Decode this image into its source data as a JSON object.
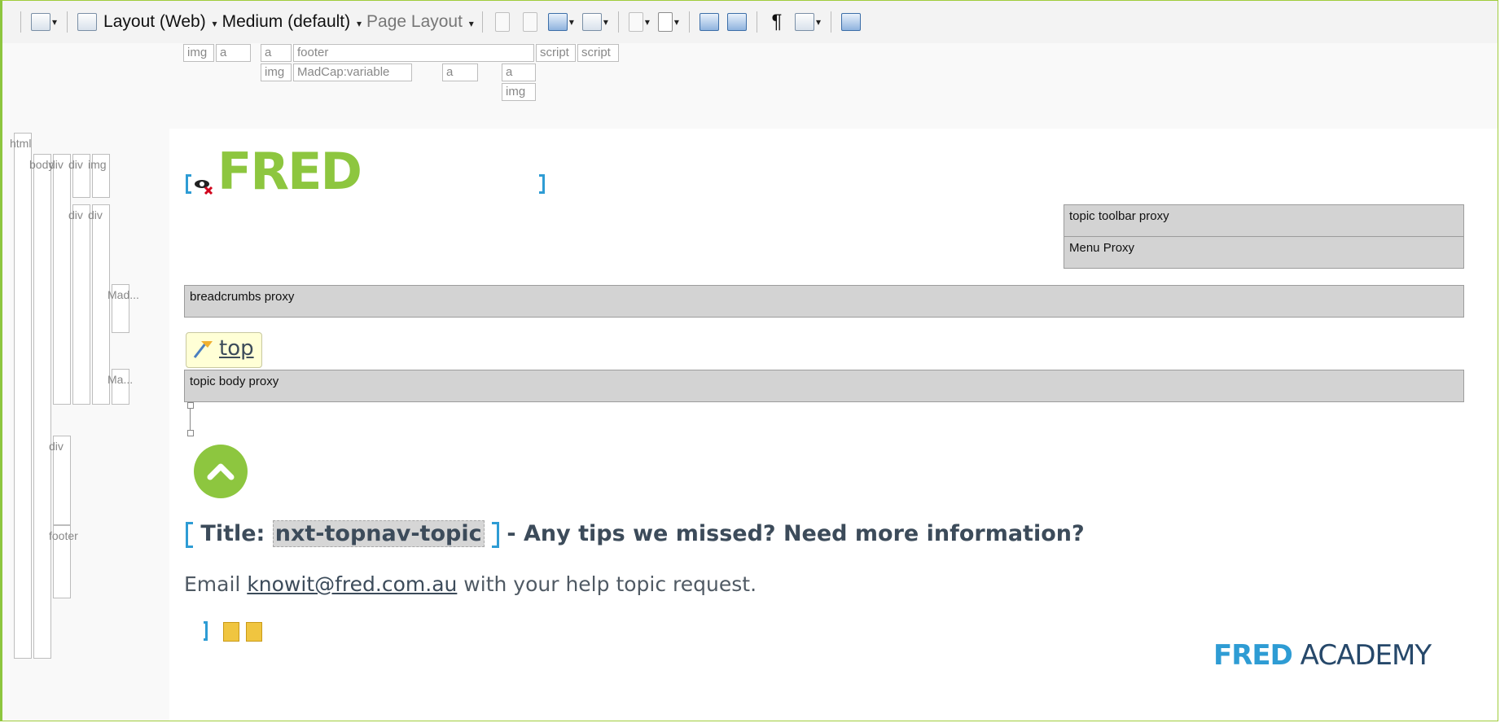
{
  "toolbar": {
    "layout": "Layout (Web)",
    "medium": "Medium (default)",
    "page_layout": "Page Layout",
    "pilcrow": "¶",
    "caret": "▾"
  },
  "structure_top": {
    "row1": [
      "img",
      "a",
      "a",
      "footer",
      "script",
      "script"
    ],
    "row2": [
      "img",
      "MadCap:variable",
      "a",
      "a"
    ],
    "row3": [
      "img"
    ]
  },
  "structure_left": [
    "html",
    "body",
    "div",
    "div",
    "img",
    "div",
    "div",
    "Mad...",
    "Ma...",
    "div",
    "footer"
  ],
  "content": {
    "logo": "FRED",
    "topic_toolbar_proxy": "topic toolbar proxy",
    "menu_proxy": "Menu Proxy",
    "breadcrumbs_proxy": "breadcrumbs proxy",
    "top_link": "top",
    "topic_body_proxy": "topic body proxy",
    "title_prefix": "Title: ",
    "title_variable": "nxt-topnav-topic",
    "title_suffix": " - Any tips we missed? Need more information?",
    "email_prefix": "Email ",
    "email": "knowit@fred.com.au",
    "email_suffix": " with your help topic request.",
    "academy_fred": "FRED",
    "academy_text": " ACADEMY"
  },
  "colors": {
    "brand_green": "#8dc63f",
    "brand_blue": "#2e9cd4",
    "proxy_gray": "#d3d3d3",
    "text": "#3c4b5a"
  }
}
